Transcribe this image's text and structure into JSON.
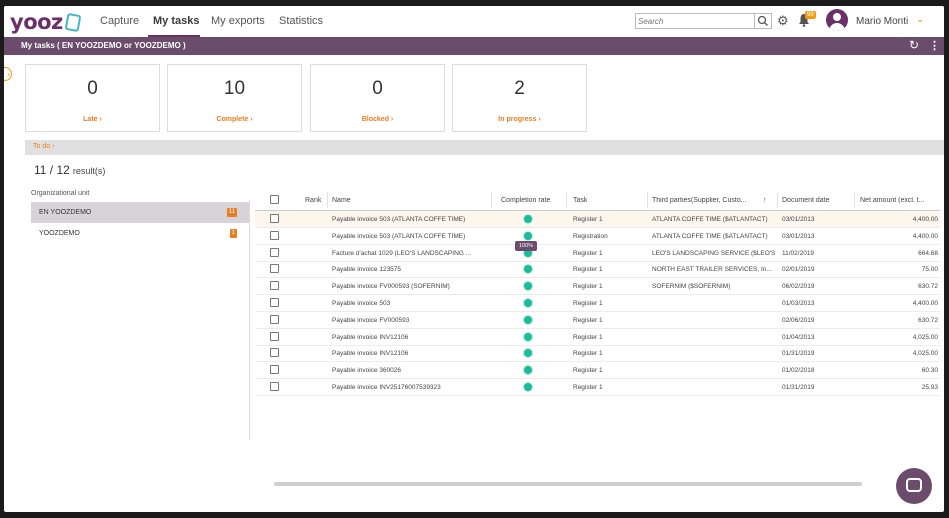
{
  "app": {
    "logo": "yooz",
    "colors": {
      "brand": "#6b4d6b",
      "accent": "#e67e22",
      "status_ok": "#1abc9c"
    }
  },
  "nav": {
    "items": [
      "Capture",
      "My tasks",
      "My exports",
      "Statistics"
    ],
    "active": "My tasks"
  },
  "search": {
    "placeholder": "Search",
    "icon": "search-icon"
  },
  "header_icons": {
    "settings": "gear-icon",
    "notifications": "bell-icon",
    "notifications_count": "99"
  },
  "user": {
    "name": "Mario Monti"
  },
  "page": {
    "title": "My tasks ( EN YOOZDEMO or YOOZDEMO )"
  },
  "cards": [
    {
      "value": "0",
      "label": "Late"
    },
    {
      "value": "10",
      "label": "Complete"
    },
    {
      "value": "0",
      "label": "Blocked"
    },
    {
      "value": "2",
      "label": "In progress"
    }
  ],
  "todo": {
    "label": "To do"
  },
  "results": {
    "count": "11 / 12",
    "suffix": "result(s)"
  },
  "org": {
    "label": "Organizational unit",
    "items": [
      {
        "name": "EN YOOZDEMO",
        "count": "11",
        "selected": true
      },
      {
        "name": "YOOZDEMO",
        "count": "1",
        "selected": false
      }
    ]
  },
  "table": {
    "columns": [
      "Rank",
      "Name",
      "Completion rate",
      "Task",
      "Third parties(Supplier, Custo...",
      "Document date",
      "Net amount (excl. t..."
    ],
    "sort_column": "Third parties(Supplier, Custo...",
    "tooltip": "100%",
    "rows": [
      {
        "name": "Payable invoice 503 (ATLANTA COFFE TIME)",
        "task": "Register 1",
        "third": "ATLANTA COFFE TIME ($ATLANTACT)",
        "date": "03/01/2013",
        "amount": "4,400.00"
      },
      {
        "name": "Payable invoice 503 (ATLANTA COFFE TIME)",
        "task": "Registration",
        "third": "ATLANTA COFFE TIME ($ATLANTACT)",
        "date": "03/01/2013",
        "amount": "4,400.00"
      },
      {
        "name": "Facture d'achat 1029 (LEO'S LANDSCAPING ...",
        "task": "Register 1",
        "third": "LEO'S LANDSCAPING SERVICE ($LEO'S...",
        "date": "11/02/2019",
        "amount": "664.68"
      },
      {
        "name": "Payable invoice 123575",
        "task": "Register 1",
        "third": "NORTH EAST TRAILER SERVICES, In...",
        "date": "02/01/2019",
        "amount": "75.00"
      },
      {
        "name": "Payable invoice FV000593 (SOFERNIM)",
        "task": "Register 1",
        "third": "SOFERNIM ($SOFERNIM)",
        "date": "06/02/2019",
        "amount": "630.72"
      },
      {
        "name": "Payable invoice 503",
        "task": "Register 1",
        "third": "",
        "date": "01/03/2013",
        "amount": "4,400.00"
      },
      {
        "name": "Payable invoice FV000593",
        "task": "Register 1",
        "third": "",
        "date": "02/06/2019",
        "amount": "630.72"
      },
      {
        "name": "Payable invoice INV12106",
        "task": "Register 1",
        "third": "",
        "date": "01/04/2013",
        "amount": "4,025.00"
      },
      {
        "name": "Payable invoice INV12106",
        "task": "Register 1",
        "third": "",
        "date": "01/31/2019",
        "amount": "4,025.00"
      },
      {
        "name": "Payable invoice 360026",
        "task": "Register 1",
        "third": "",
        "date": "01/02/2018",
        "amount": "60.30"
      },
      {
        "name": "Payable invoice INV25176007539323",
        "task": "Register 1",
        "third": "",
        "date": "01/31/2019",
        "amount": "25.93"
      }
    ]
  }
}
